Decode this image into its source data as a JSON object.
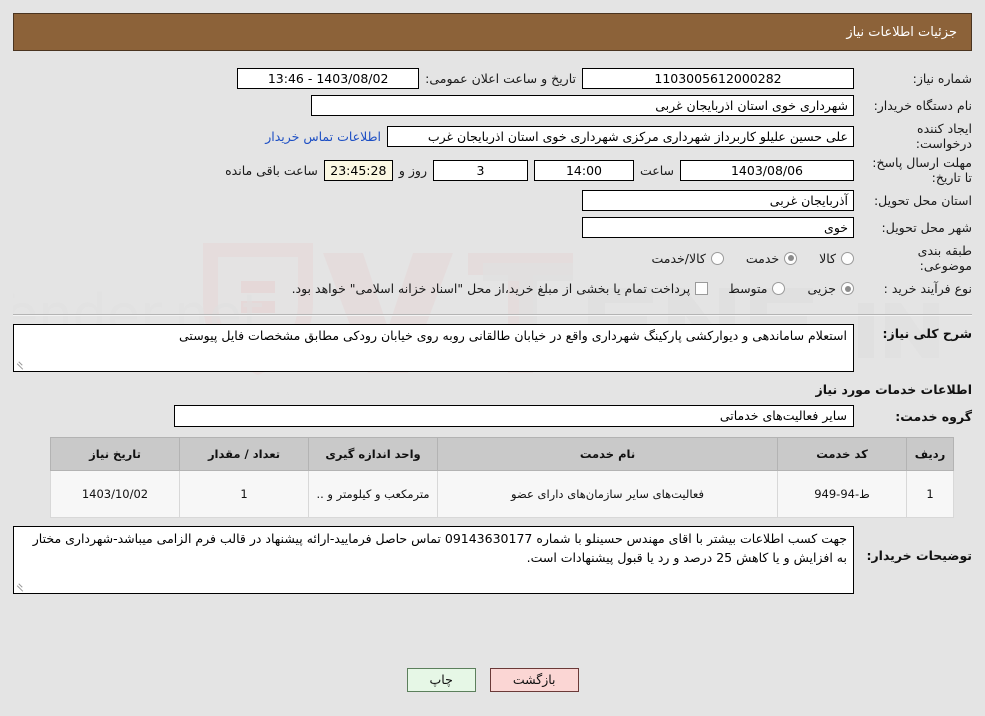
{
  "header": {
    "title": "جزئیات اطلاعات نیاز"
  },
  "form": {
    "need_no_label": "شماره نیاز:",
    "need_no_value": "1103005612000282",
    "public_announce_label": "تاریخ و ساعت اعلان عمومی:",
    "public_announce_value": "1403/08/02 - 13:46",
    "buyer_org_label": "نام دستگاه خریدار:",
    "buyer_org_value": "شهرداری خوی استان اذربایجان غربی",
    "creator_label": "ایجاد کننده درخواست:",
    "creator_value": "علی حسین علیلو کاربرداز شهرداری مرکزی شهرداری خوی استان اذربایجان غرب",
    "buyer_contact_link": "اطلاعات تماس خریدار",
    "deadline_label": "مهلت ارسال پاسخ: تا تاریخ:",
    "deadline_date": "1403/08/06",
    "hour_label": "ساعت",
    "deadline_hour": "14:00",
    "days_value": "3",
    "days_label": "روز و",
    "remaining_value": "23:45:28",
    "remaining_label": "ساعت باقی مانده",
    "province_label": "استان محل تحویل:",
    "province_value": "آذربایجان غربی",
    "city_label": "شهر محل تحویل:",
    "city_value": "خوی",
    "classification_label": "طبقه بندی موضوعی:",
    "classification_options": [
      {
        "label": "کالا",
        "checked": false
      },
      {
        "label": "خدمت",
        "checked": true
      },
      {
        "label": "کالا/خدمت",
        "checked": false
      }
    ],
    "process_label": "نوع فرآیند خرید :",
    "process_options": [
      {
        "label": "جزیی",
        "checked": true
      },
      {
        "label": "متوسط",
        "checked": false
      }
    ],
    "treasury_checkbox_text": "پرداخت تمام یا بخشی از مبلغ خرید،از محل \"اسناد خزانه اسلامی\" خواهد بود.",
    "treasury_checked": false
  },
  "description": {
    "label": "شرح کلی نیاز:",
    "value": "استعلام ساماندهی و دیوارکشی پارکینگ شهرداری واقع در خیابان طالقانی روبه روی خیابان رودکی مطابق مشخصات فایل پیوستی"
  },
  "services_section": {
    "title": "اطلاعات خدمات مورد نیاز",
    "group_label": "گروه خدمت:",
    "group_value": "سایر فعالیت‌های خدماتی"
  },
  "table": {
    "columns": [
      "ردیف",
      "کد خدمت",
      "نام خدمت",
      "واحد اندازه گیری",
      "تعداد / مقدار",
      "تاریخ نیاز"
    ],
    "rows": [
      {
        "radif": "1",
        "code": "ط-94-949",
        "name": "فعالیت‌های سایر سازمان‌های دارای عضو",
        "unit": "مترمکعب و کیلومتر و ..",
        "qty": "1",
        "date": "1403/10/02"
      }
    ]
  },
  "notes": {
    "label": "توضیحات خریدار:",
    "value": "جهت کسب اطلاعات بیشتر با اقای مهندس حسینلو با شماره 09143630177 تماس حاصل فرمایید-ارائه پیشنهاد در قالب فرم الزامی میباشد-شهرداری مختار به افزایش و یا کاهش 25 درصد و رد یا قبول پیشنهادات است."
  },
  "footer": {
    "print_label": "چاپ",
    "back_label": "بازگشت"
  },
  "watermark": {
    "text": "AriaTender.net"
  },
  "colors": {
    "header_bg": "#8c6239",
    "page_bg": "#e4e4e4",
    "link": "#1d4fc4",
    "table_header_bg": "#c9c9c9",
    "print_btn": "#e6f7e6",
    "back_btn": "#fbd6d4",
    "countdown_bg": "#fbf8e3"
  }
}
